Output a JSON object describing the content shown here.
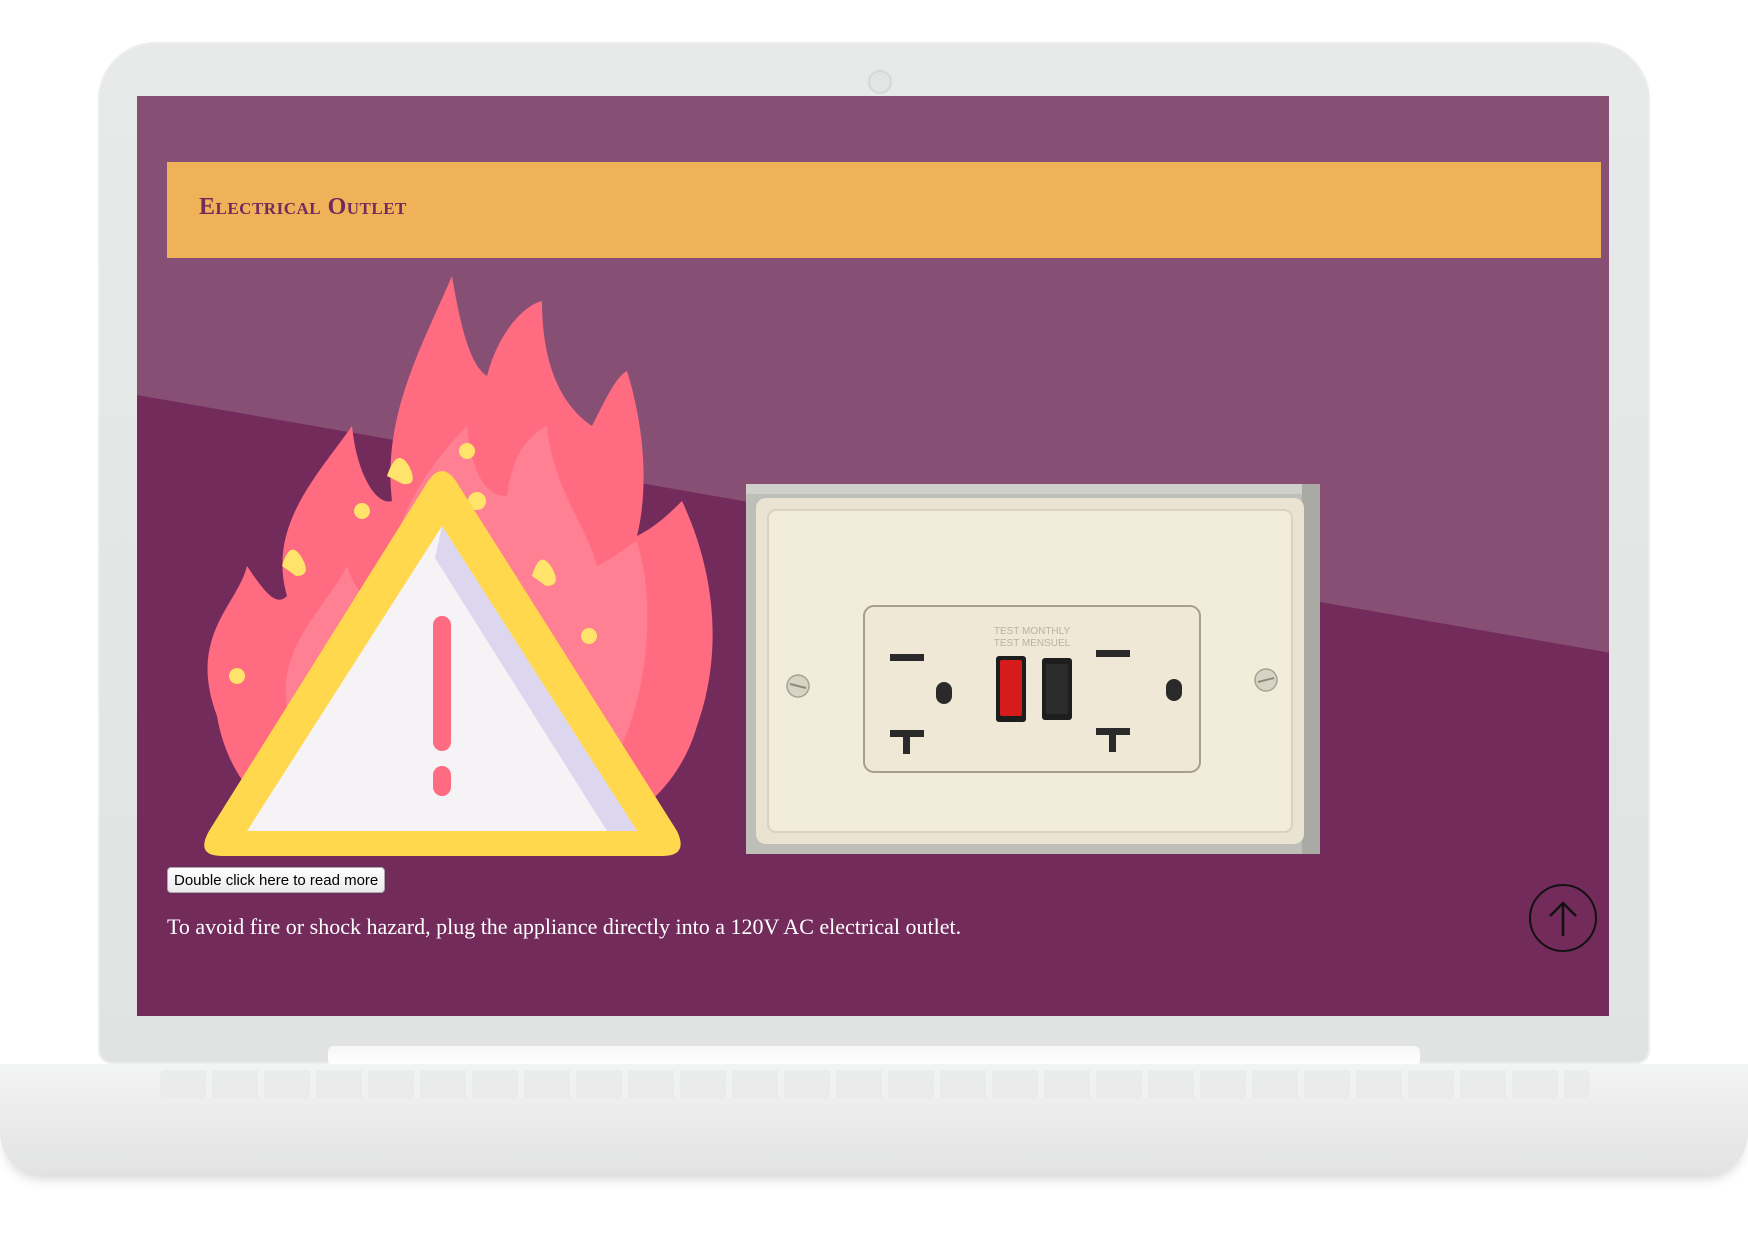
{
  "slide": {
    "title": "Electrical Outlet",
    "read_more_button": "Double click here to read more",
    "body_text": "To avoid fire or shock hazard, plug the appliance directly into a 120V AC electrical outlet."
  },
  "outlet_photo": {
    "label_test_monthly": "TEST MONTHLY",
    "label_test_mensuel": "TEST MENSUEL"
  },
  "icons": {
    "hazard": "fire-warning-icon",
    "scroll": "arrow-up-circle-icon"
  },
  "colors": {
    "screen_bg": "#732b5c",
    "title_bar": "#efb258",
    "title_text": "#732b5c"
  }
}
